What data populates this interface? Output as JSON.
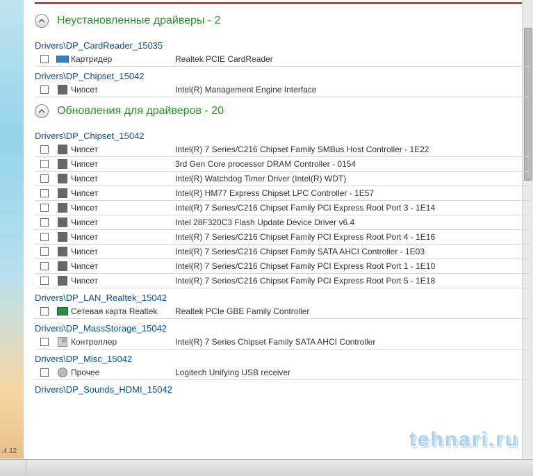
{
  "sections": {
    "uninstalled": {
      "title": "Неустановленные драйверы -   2"
    },
    "updates": {
      "title": "Обновления для драйверов -   20"
    }
  },
  "groups": {
    "cardreader": {
      "link": "Drivers\\DP_CardReader_15035"
    },
    "chipset_u": {
      "link": "Drivers\\DP_Chipset_15042"
    },
    "chipset": {
      "link": "Drivers\\DP_Chipset_15042"
    },
    "lan": {
      "link": "Drivers\\DP_LAN_Realtek_15042"
    },
    "massstorage": {
      "link": "Drivers\\DP_MassStorage_15042"
    },
    "misc": {
      "link": "Drivers\\DP_Misc_15042"
    },
    "sounds": {
      "link": "Drivers\\DP_Sounds_HDMI_15042"
    }
  },
  "cat": {
    "cardreader": "Картридер",
    "chipset": "Чипсет",
    "lan": "Сетевая карта Realtek",
    "storage": "Контроллер",
    "misc": "Прочее"
  },
  "uninstalled_rows": [
    {
      "cat": "cardreader",
      "icon": "cardreader",
      "desc": "Realtek PCIE CardReader"
    },
    {
      "cat": "chipset",
      "icon": "chip",
      "desc": "Intel(R) Management Engine Interface"
    }
  ],
  "chipset_rows": [
    {
      "desc": "Intel(R) 7 Series/C216 Chipset Family SMBus Host Controller - 1E22"
    },
    {
      "desc": "3rd Gen Core processor DRAM Controller - 0154"
    },
    {
      "desc": "Intel(R) Watchdog Timer Driver (Intel(R) WDT)"
    },
    {
      "desc": "Intel(R) HM77 Express Chipset LPC Controller - 1E57"
    },
    {
      "desc": "Intel(R) 7 Series/C216 Chipset Family PCI Express Root Port 3 - 1E14"
    },
    {
      "desc": "Intel 28F320C3 Flash Update Device Driver v6.4"
    },
    {
      "desc": "Intel(R) 7 Series/C216 Chipset Family PCI Express Root Port 4 - 1E16"
    },
    {
      "desc": "Intel(R) 7 Series/C216 Chipset Family SATA AHCI Controller - 1E03"
    },
    {
      "desc": "Intel(R) 7 Series/C216 Chipset Family PCI Express Root Port 1 - 1E10"
    },
    {
      "desc": "Intel(R) 7 Series/C216 Chipset Family PCI Express Root Port 5 - 1E18"
    }
  ],
  "lan_row": {
    "desc": "Realtek PCIe GBE Family Controller"
  },
  "storage_row": {
    "desc": "Intel(R) 7 Series Chipset Family SATA AHCI Controller"
  },
  "misc_row": {
    "desc": "Logitech Unifying USB receiver"
  },
  "watermark": "tehnari.ru",
  "version": ".4.12"
}
